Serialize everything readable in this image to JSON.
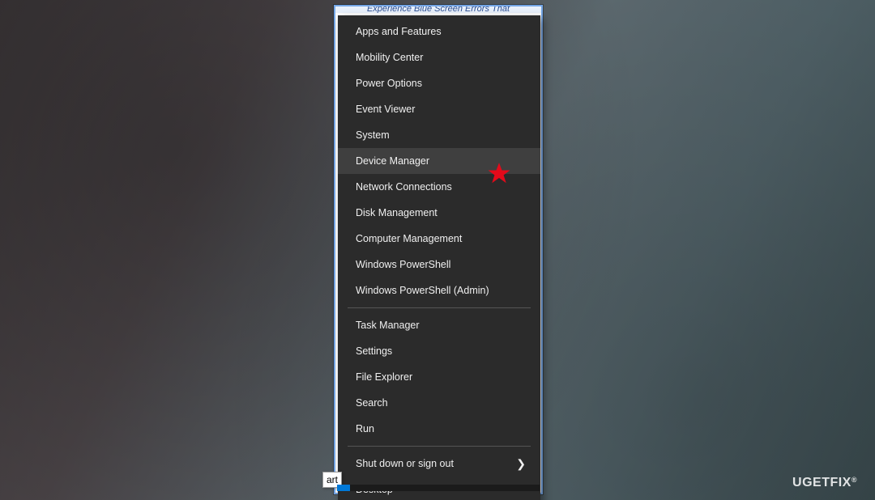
{
  "cropped_header": "Experience Blue Screen Errors That",
  "menu": {
    "group1": [
      {
        "label": "Apps and Features"
      },
      {
        "label": "Mobility Center"
      },
      {
        "label": "Power Options"
      },
      {
        "label": "Event Viewer"
      },
      {
        "label": "System"
      },
      {
        "label": "Device Manager",
        "highlight": true,
        "star": true
      },
      {
        "label": "Network Connections"
      },
      {
        "label": "Disk Management"
      },
      {
        "label": "Computer Management"
      },
      {
        "label": "Windows PowerShell"
      },
      {
        "label": "Windows PowerShell (Admin)"
      }
    ],
    "group2": [
      {
        "label": "Task Manager"
      },
      {
        "label": "Settings"
      },
      {
        "label": "File Explorer"
      },
      {
        "label": "Search"
      },
      {
        "label": "Run"
      }
    ],
    "group3": [
      {
        "label": "Shut down or sign out",
        "submenu": true
      },
      {
        "label": "Desktop"
      }
    ]
  },
  "start_tooltip": "art",
  "watermark": "UGETFIX",
  "annotation": {
    "star_color": "#e40a1a"
  }
}
